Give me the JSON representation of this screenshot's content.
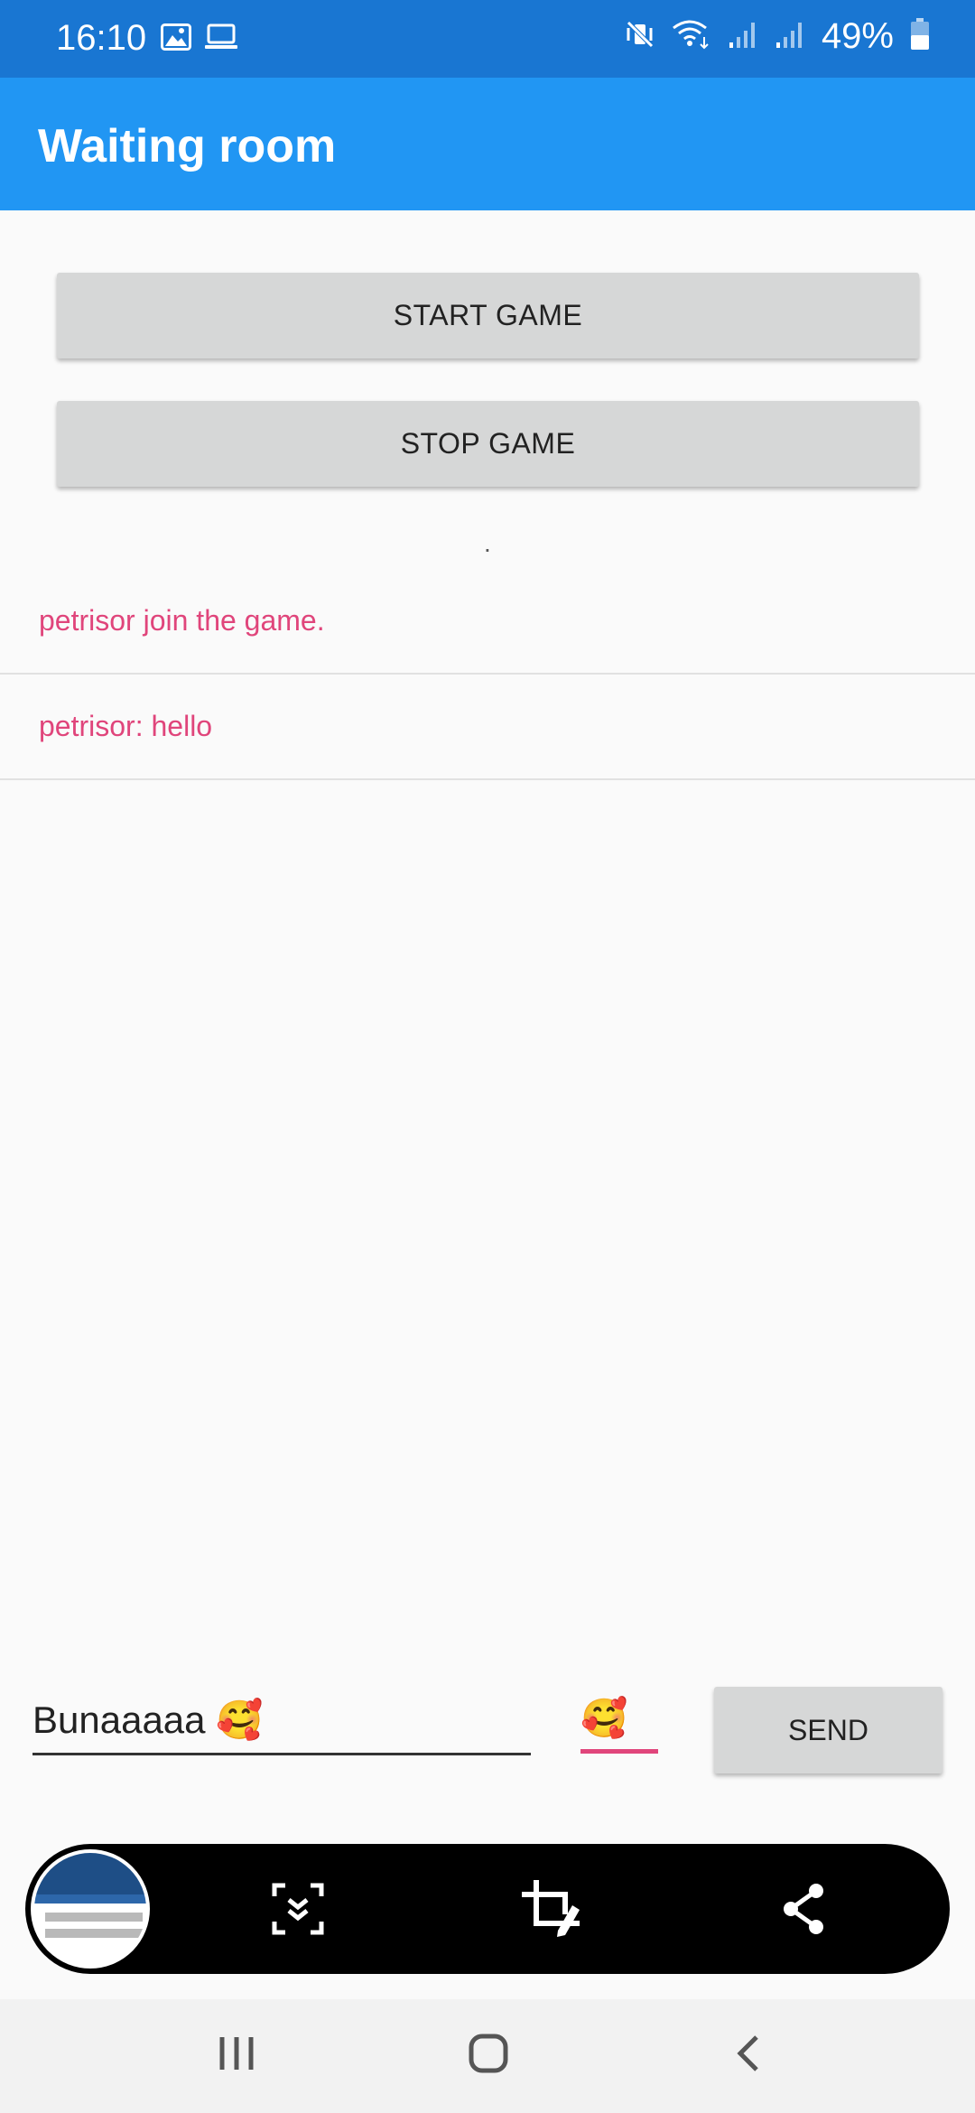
{
  "status_bar": {
    "time": "16:10",
    "battery": "49%",
    "icons": [
      "gallery-icon",
      "laptop-icon",
      "mute-vibrate-icon",
      "wifi-icon",
      "signal-icon",
      "signal-icon",
      "battery-icon"
    ],
    "background": "#1976d2"
  },
  "app_bar": {
    "title": "Waiting room",
    "background": "#2196f3"
  },
  "buttons": {
    "start_label": "START GAME",
    "stop_label": "STOP GAME"
  },
  "status_dot": ".",
  "messages": [
    {
      "text": "petrisor join the game."
    },
    {
      "text": "petrisor: hello"
    }
  ],
  "message_color": "#e0457b",
  "composer": {
    "input_value": "Bunaaaaa 🥰",
    "emoji_value": "🥰",
    "send_label": "SEND"
  },
  "screenshot_toolbar": {
    "icons": [
      "thumbnail",
      "scroll-capture-icon",
      "crop-edit-icon",
      "share-icon"
    ]
  },
  "nav_bar": {
    "icons": [
      "recents-icon",
      "home-icon",
      "back-icon"
    ]
  }
}
